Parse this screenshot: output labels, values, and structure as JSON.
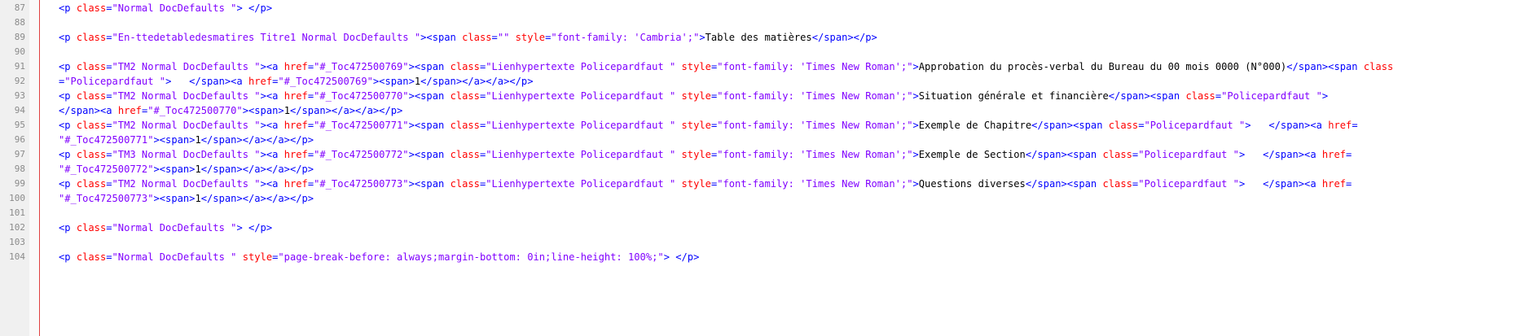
{
  "colors": {
    "tag": "#0000ff",
    "attribute": "#ff0000",
    "string": "#8000ff",
    "text": "#000000",
    "gutter_bg": "#f0f0f0",
    "line_number": "#8a8a8a",
    "margin_marker": "#e04040"
  },
  "line_numbers": [
    "87",
    "88",
    "89",
    "90",
    "91",
    "92",
    "93",
    "94",
    "95",
    "96",
    "97",
    "98",
    "99",
    "100",
    "101",
    "102",
    "103",
    "104"
  ],
  "rows": [
    [
      {
        "t": "tag",
        "s": "<p "
      },
      {
        "t": "attr",
        "s": "class"
      },
      {
        "t": "tag",
        "s": "="
      },
      {
        "t": "str",
        "s": "\"Normal DocDefaults \""
      },
      {
        "t": "tag",
        "s": "> </p>"
      }
    ],
    [],
    [
      {
        "t": "tag",
        "s": "<p "
      },
      {
        "t": "attr",
        "s": "class"
      },
      {
        "t": "tag",
        "s": "="
      },
      {
        "t": "str",
        "s": "\"En-ttedetabledesmatires Titre1 Normal DocDefaults \""
      },
      {
        "t": "tag",
        "s": "><span "
      },
      {
        "t": "attr",
        "s": "class"
      },
      {
        "t": "tag",
        "s": "="
      },
      {
        "t": "str",
        "s": "\"\""
      },
      {
        "t": "tag",
        "s": " "
      },
      {
        "t": "attr",
        "s": "style"
      },
      {
        "t": "tag",
        "s": "="
      },
      {
        "t": "str",
        "s": "\"font-family: 'Cambria';\""
      },
      {
        "t": "tag",
        "s": ">"
      },
      {
        "t": "text",
        "s": "Table des matières"
      },
      {
        "t": "tag",
        "s": "</span></p>"
      }
    ],
    [],
    [
      {
        "t": "tag",
        "s": "<p "
      },
      {
        "t": "attr",
        "s": "class"
      },
      {
        "t": "tag",
        "s": "="
      },
      {
        "t": "str",
        "s": "\"TM2 Normal DocDefaults \""
      },
      {
        "t": "tag",
        "s": "><a "
      },
      {
        "t": "attr",
        "s": "href"
      },
      {
        "t": "tag",
        "s": "="
      },
      {
        "t": "str",
        "s": "\"#_Toc472500769\""
      },
      {
        "t": "tag",
        "s": "><span "
      },
      {
        "t": "attr",
        "s": "class"
      },
      {
        "t": "tag",
        "s": "="
      },
      {
        "t": "str",
        "s": "\"Lienhypertexte Policepardfaut \""
      },
      {
        "t": "tag",
        "s": " "
      },
      {
        "t": "attr",
        "s": "style"
      },
      {
        "t": "tag",
        "s": "="
      },
      {
        "t": "str",
        "s": "\"font-family: 'Times New Roman';\""
      },
      {
        "t": "tag",
        "s": ">"
      },
      {
        "t": "text",
        "s": "Approbation du procès-verbal du Bureau du 00 mois 0000 (N°000)"
      },
      {
        "t": "tag",
        "s": "</span><span "
      },
      {
        "t": "attr",
        "s": "class"
      }
    ],
    [
      {
        "t": "tag",
        "s": "="
      },
      {
        "t": "str",
        "s": "\"Policepardfaut \""
      },
      {
        "t": "tag",
        "s": ">   </span><a "
      },
      {
        "t": "attr",
        "s": "href"
      },
      {
        "t": "tag",
        "s": "="
      },
      {
        "t": "str",
        "s": "\"#_Toc472500769\""
      },
      {
        "t": "tag",
        "s": "><span>"
      },
      {
        "t": "text",
        "s": "1"
      },
      {
        "t": "tag",
        "s": "</span></a></a></p>"
      }
    ],
    [
      {
        "t": "tag",
        "s": "<p "
      },
      {
        "t": "attr",
        "s": "class"
      },
      {
        "t": "tag",
        "s": "="
      },
      {
        "t": "str",
        "s": "\"TM2 Normal DocDefaults \""
      },
      {
        "t": "tag",
        "s": "><a "
      },
      {
        "t": "attr",
        "s": "href"
      },
      {
        "t": "tag",
        "s": "="
      },
      {
        "t": "str",
        "s": "\"#_Toc472500770\""
      },
      {
        "t": "tag",
        "s": "><span "
      },
      {
        "t": "attr",
        "s": "class"
      },
      {
        "t": "tag",
        "s": "="
      },
      {
        "t": "str",
        "s": "\"Lienhypertexte Policepardfaut \""
      },
      {
        "t": "tag",
        "s": " "
      },
      {
        "t": "attr",
        "s": "style"
      },
      {
        "t": "tag",
        "s": "="
      },
      {
        "t": "str",
        "s": "\"font-family: 'Times New Roman';\""
      },
      {
        "t": "tag",
        "s": ">"
      },
      {
        "t": "text",
        "s": "Situation générale et financière"
      },
      {
        "t": "tag",
        "s": "</span><span "
      },
      {
        "t": "attr",
        "s": "class"
      },
      {
        "t": "tag",
        "s": "="
      },
      {
        "t": "str",
        "s": "\"Policepardfaut \""
      },
      {
        "t": "tag",
        "s": ">"
      }
    ],
    [
      {
        "t": "tag",
        "s": "</span><a "
      },
      {
        "t": "attr",
        "s": "href"
      },
      {
        "t": "tag",
        "s": "="
      },
      {
        "t": "str",
        "s": "\"#_Toc472500770\""
      },
      {
        "t": "tag",
        "s": "><span>"
      },
      {
        "t": "text",
        "s": "1"
      },
      {
        "t": "tag",
        "s": "</span></a></a></p>"
      }
    ],
    [
      {
        "t": "tag",
        "s": "<p "
      },
      {
        "t": "attr",
        "s": "class"
      },
      {
        "t": "tag",
        "s": "="
      },
      {
        "t": "str",
        "s": "\"TM2 Normal DocDefaults \""
      },
      {
        "t": "tag",
        "s": "><a "
      },
      {
        "t": "attr",
        "s": "href"
      },
      {
        "t": "tag",
        "s": "="
      },
      {
        "t": "str",
        "s": "\"#_Toc472500771\""
      },
      {
        "t": "tag",
        "s": "><span "
      },
      {
        "t": "attr",
        "s": "class"
      },
      {
        "t": "tag",
        "s": "="
      },
      {
        "t": "str",
        "s": "\"Lienhypertexte Policepardfaut \""
      },
      {
        "t": "tag",
        "s": " "
      },
      {
        "t": "attr",
        "s": "style"
      },
      {
        "t": "tag",
        "s": "="
      },
      {
        "t": "str",
        "s": "\"font-family: 'Times New Roman';\""
      },
      {
        "t": "tag",
        "s": ">"
      },
      {
        "t": "text",
        "s": "Exemple de Chapitre"
      },
      {
        "t": "tag",
        "s": "</span><span "
      },
      {
        "t": "attr",
        "s": "class"
      },
      {
        "t": "tag",
        "s": "="
      },
      {
        "t": "str",
        "s": "\"Policepardfaut \""
      },
      {
        "t": "tag",
        "s": ">   </span><a "
      },
      {
        "t": "attr",
        "s": "href"
      },
      {
        "t": "tag",
        "s": "="
      }
    ],
    [
      {
        "t": "str",
        "s": "\"#_Toc472500771\""
      },
      {
        "t": "tag",
        "s": "><span>"
      },
      {
        "t": "text",
        "s": "1"
      },
      {
        "t": "tag",
        "s": "</span></a></a></p>"
      }
    ],
    [
      {
        "t": "tag",
        "s": "<p "
      },
      {
        "t": "attr",
        "s": "class"
      },
      {
        "t": "tag",
        "s": "="
      },
      {
        "t": "str",
        "s": "\"TM3 Normal DocDefaults \""
      },
      {
        "t": "tag",
        "s": "><a "
      },
      {
        "t": "attr",
        "s": "href"
      },
      {
        "t": "tag",
        "s": "="
      },
      {
        "t": "str",
        "s": "\"#_Toc472500772\""
      },
      {
        "t": "tag",
        "s": "><span "
      },
      {
        "t": "attr",
        "s": "class"
      },
      {
        "t": "tag",
        "s": "="
      },
      {
        "t": "str",
        "s": "\"Lienhypertexte Policepardfaut \""
      },
      {
        "t": "tag",
        "s": " "
      },
      {
        "t": "attr",
        "s": "style"
      },
      {
        "t": "tag",
        "s": "="
      },
      {
        "t": "str",
        "s": "\"font-family: 'Times New Roman';\""
      },
      {
        "t": "tag",
        "s": ">"
      },
      {
        "t": "text",
        "s": "Exemple de Section"
      },
      {
        "t": "tag",
        "s": "</span><span "
      },
      {
        "t": "attr",
        "s": "class"
      },
      {
        "t": "tag",
        "s": "="
      },
      {
        "t": "str",
        "s": "\"Policepardfaut \""
      },
      {
        "t": "tag",
        "s": ">   </span><a "
      },
      {
        "t": "attr",
        "s": "href"
      },
      {
        "t": "tag",
        "s": "="
      }
    ],
    [
      {
        "t": "str",
        "s": "\"#_Toc472500772\""
      },
      {
        "t": "tag",
        "s": "><span>"
      },
      {
        "t": "text",
        "s": "1"
      },
      {
        "t": "tag",
        "s": "</span></a></a></p>"
      }
    ],
    [
      {
        "t": "tag",
        "s": "<p "
      },
      {
        "t": "attr",
        "s": "class"
      },
      {
        "t": "tag",
        "s": "="
      },
      {
        "t": "str",
        "s": "\"TM2 Normal DocDefaults \""
      },
      {
        "t": "tag",
        "s": "><a "
      },
      {
        "t": "attr",
        "s": "href"
      },
      {
        "t": "tag",
        "s": "="
      },
      {
        "t": "str",
        "s": "\"#_Toc472500773\""
      },
      {
        "t": "tag",
        "s": "><span "
      },
      {
        "t": "attr",
        "s": "class"
      },
      {
        "t": "tag",
        "s": "="
      },
      {
        "t": "str",
        "s": "\"Lienhypertexte Policepardfaut \""
      },
      {
        "t": "tag",
        "s": " "
      },
      {
        "t": "attr",
        "s": "style"
      },
      {
        "t": "tag",
        "s": "="
      },
      {
        "t": "str",
        "s": "\"font-family: 'Times New Roman';\""
      },
      {
        "t": "tag",
        "s": ">"
      },
      {
        "t": "text",
        "s": "Questions diverses"
      },
      {
        "t": "tag",
        "s": "</span><span "
      },
      {
        "t": "attr",
        "s": "class"
      },
      {
        "t": "tag",
        "s": "="
      },
      {
        "t": "str",
        "s": "\"Policepardfaut \""
      },
      {
        "t": "tag",
        "s": ">   </span><a "
      },
      {
        "t": "attr",
        "s": "href"
      },
      {
        "t": "tag",
        "s": "="
      }
    ],
    [
      {
        "t": "str",
        "s": "\"#_Toc472500773\""
      },
      {
        "t": "tag",
        "s": "><span>"
      },
      {
        "t": "text",
        "s": "1"
      },
      {
        "t": "tag",
        "s": "</span></a></a></p>"
      }
    ],
    [],
    [
      {
        "t": "tag",
        "s": "<p "
      },
      {
        "t": "attr",
        "s": "class"
      },
      {
        "t": "tag",
        "s": "="
      },
      {
        "t": "str",
        "s": "\"Normal DocDefaults \""
      },
      {
        "t": "tag",
        "s": "> </p>"
      }
    ],
    [],
    [
      {
        "t": "tag",
        "s": "<p "
      },
      {
        "t": "attr",
        "s": "class"
      },
      {
        "t": "tag",
        "s": "="
      },
      {
        "t": "str",
        "s": "\"Normal DocDefaults \""
      },
      {
        "t": "tag",
        "s": " "
      },
      {
        "t": "attr",
        "s": "style"
      },
      {
        "t": "tag",
        "s": "="
      },
      {
        "t": "str",
        "s": "\"page-break-before: always;margin-bottom: 0in;line-height: 100%;\""
      },
      {
        "t": "tag",
        "s": "> </p>"
      }
    ],
    []
  ]
}
